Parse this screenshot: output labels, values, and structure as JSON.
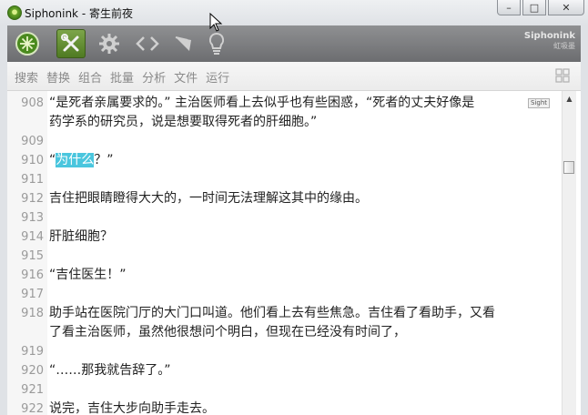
{
  "window": {
    "title": "Siphonink - 寄生前夜",
    "controls": {
      "minimize": "–",
      "maximize": "□",
      "close": "✕"
    }
  },
  "toolbar": {
    "icons": [
      "siphonink-logo-icon",
      "tools-icon",
      "gear-icon",
      "code-icon",
      "pin-icon",
      "lightbulb-icon"
    ],
    "selected": "tools-icon",
    "brand_en": "Siphonink",
    "brand_cn": "虹吸墨"
  },
  "menu": {
    "items": [
      "搜索",
      "替换",
      "组合",
      "批量",
      "分析",
      "文件",
      "运行"
    ]
  },
  "editor": {
    "sight_label": "Sight",
    "lines": [
      {
        "num": "908",
        "text": "“是死者亲属要求的。” 主治医师看上去似乎也有些困惑，“死者的丈夫好像是"
      },
      {
        "num": "",
        "text": "药学系的研究员，说是想要取得死者的肝细胞。”"
      },
      {
        "num": "909",
        "text": ""
      },
      {
        "num": "910",
        "pre": "“",
        "hl": "为什么",
        "post": "？”"
      },
      {
        "num": "911",
        "text": ""
      },
      {
        "num": "912",
        "text": "吉住把眼睛瞪得大大的，一时间无法理解这其中的缘由。"
      },
      {
        "num": "913",
        "text": ""
      },
      {
        "num": "914",
        "text": "肝脏细胞？"
      },
      {
        "num": "915",
        "text": ""
      },
      {
        "num": "916",
        "text": "“吉住医生！”"
      },
      {
        "num": "917",
        "text": ""
      },
      {
        "num": "918",
        "text": "助手站在医院门厅的大门口叫道。他们看上去有些焦急。吉住看了看助手，又看"
      },
      {
        "num": "",
        "text": "了看主治医师，虽然他很想问个明白，但现在已经没有时间了，"
      },
      {
        "num": "919",
        "text": ""
      },
      {
        "num": "920",
        "text": "“……那我就告辞了。”"
      },
      {
        "num": "921",
        "text": ""
      },
      {
        "num": "922",
        "text": "说完，吉住大步向助手走去。"
      }
    ]
  },
  "colors": {
    "highlight": "#4ac6de",
    "toolbar": "#7d7e80",
    "selected_tool": "#6a9a3a"
  }
}
